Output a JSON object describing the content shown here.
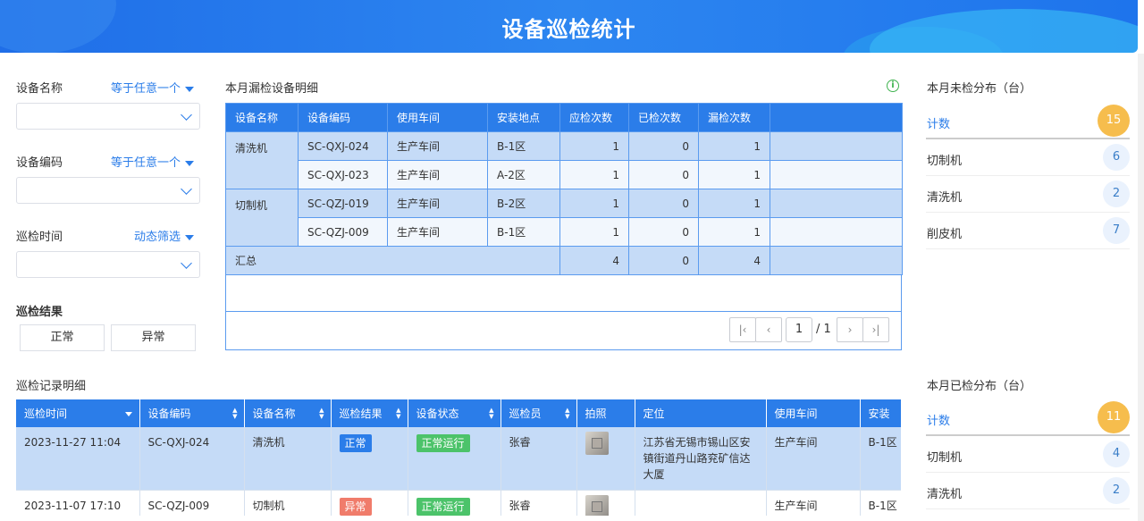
{
  "header": {
    "title": "设备巡检统计"
  },
  "filters": {
    "device_name": {
      "label": "设备名称",
      "mode": "等于任意一个"
    },
    "device_code": {
      "label": "设备编码",
      "mode": "等于任意一个"
    },
    "inspect_time": {
      "label": "巡检时间",
      "mode": "动态筛选"
    },
    "result": {
      "label": "巡检结果",
      "options": [
        "正常",
        "异常"
      ]
    }
  },
  "missed": {
    "title": "本月漏检设备明细",
    "columns": [
      "设备名称",
      "设备编码",
      "使用车间",
      "安装地点",
      "应检次数",
      "已检次数",
      "漏检次数"
    ],
    "rows": [
      {
        "name": "清洗机",
        "code": "SC-QXJ-024",
        "workshop": "生产车间",
        "location": "B-1区",
        "due": "1",
        "done": "0",
        "missed": "1"
      },
      {
        "name": "",
        "code": "SC-QXJ-023",
        "workshop": "生产车间",
        "location": "A-2区",
        "due": "1",
        "done": "0",
        "missed": "1"
      },
      {
        "name": "切制机",
        "code": "SC-QZJ-019",
        "workshop": "生产车间",
        "location": "B-2区",
        "due": "1",
        "done": "0",
        "missed": "1"
      },
      {
        "name": "",
        "code": "SC-QZJ-009",
        "workshop": "生产车间",
        "location": "B-1区",
        "due": "1",
        "done": "0",
        "missed": "1"
      }
    ],
    "total": {
      "label": "汇总",
      "due": "4",
      "done": "0",
      "missed": "4"
    },
    "pagination": {
      "page": "1",
      "total": "/ 1"
    }
  },
  "unchecked_dist": {
    "title": "本月未检分布（台）",
    "head": {
      "label": "计数",
      "value": "15"
    },
    "items": [
      {
        "label": "切制机",
        "value": "6"
      },
      {
        "label": "清洗机",
        "value": "2"
      },
      {
        "label": "削皮机",
        "value": "7"
      }
    ]
  },
  "checked_dist": {
    "title": "本月已检分布（台）",
    "head": {
      "label": "计数",
      "value": "11"
    },
    "items": [
      {
        "label": "切制机",
        "value": "4"
      },
      {
        "label": "清洗机",
        "value": "2"
      }
    ]
  },
  "records": {
    "title": "巡检记录明细",
    "columns": [
      "巡检时间",
      "设备编码",
      "设备名称",
      "巡检结果",
      "设备状态",
      "巡检员",
      "拍照",
      "定位",
      "使用车间",
      "安装"
    ],
    "rows": [
      {
        "time": "2023-11-27 11:04",
        "code": "SC-QXJ-024",
        "name": "清洗机",
        "result": "正常",
        "status": "正常运行",
        "inspector": "张睿",
        "location": "江苏省无锡市锡山区安镇街道丹山路兖矿信达大厦",
        "workshop": "生产车间",
        "place": "B-1区"
      },
      {
        "time": "2023-11-07 17:10",
        "code": "SC-QZJ-009",
        "name": "切制机",
        "result": "异常",
        "status": "正常运行",
        "inspector": "张睿",
        "location": "",
        "workshop": "生产车间",
        "place": "B-1区"
      }
    ]
  },
  "colors": {
    "primary": "#2b7de9",
    "orange": "#f6bd4d",
    "normal": "#2b7de9",
    "abnormal": "#f07c6b",
    "running": "#4cc36a"
  }
}
